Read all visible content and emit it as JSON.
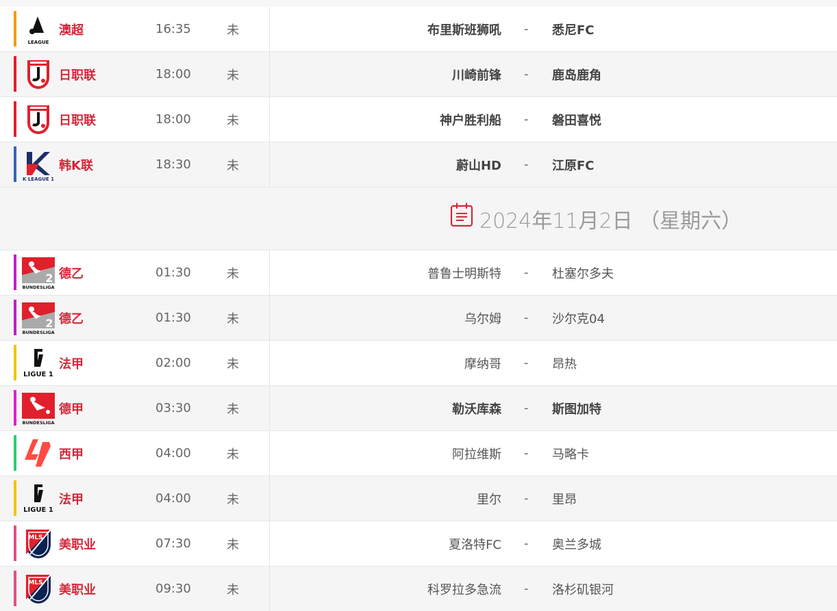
{
  "date_separator": {
    "date": "2024年11月2日",
    "weekday": "（星期六）",
    "icon": "calendar-icon"
  },
  "matches_before": [
    {
      "league": "澳超",
      "logo": "a-league-logo",
      "color": "#f39c12",
      "time": "16:35",
      "status": "未",
      "home": "布里斯班狮吼",
      "dash": "-",
      "away": "悉尼FC",
      "bold": true,
      "bg": "white"
    },
    {
      "league": "日职联",
      "logo": "j-league-logo",
      "color": "#e0202c",
      "time": "18:00",
      "status": "未",
      "home": "川崎前锋",
      "dash": "-",
      "away": "鹿岛鹿角",
      "bold": true,
      "bg": "grey"
    },
    {
      "league": "日职联",
      "logo": "j-league-logo",
      "color": "#e0202c",
      "time": "18:00",
      "status": "未",
      "home": "神户胜利船",
      "dash": "-",
      "away": "磐田喜悦",
      "bold": true,
      "bg": "white"
    },
    {
      "league": "韩K联",
      "logo": "k-league-logo",
      "color": "#3a62b8",
      "time": "18:30",
      "status": "未",
      "home": "蔚山HD",
      "dash": "-",
      "away": "江原FC",
      "bold": true,
      "bg": "grey"
    }
  ],
  "matches_after": [
    {
      "league": "德乙",
      "logo": "bundesliga-2-logo",
      "color": "#c21fc2",
      "time": "01:30",
      "status": "未",
      "home": "普鲁士明斯特",
      "dash": "-",
      "away": "杜塞尔多夫",
      "bold": false,
      "bg": "white"
    },
    {
      "league": "德乙",
      "logo": "bundesliga-2-logo",
      "color": "#c21fc2",
      "time": "01:30",
      "status": "未",
      "home": "乌尔姆",
      "dash": "-",
      "away": "沙尔克04",
      "bold": false,
      "bg": "grey"
    },
    {
      "league": "法甲",
      "logo": "ligue-1-logo",
      "color": "#f1c40f",
      "time": "02:00",
      "status": "未",
      "home": "摩纳哥",
      "dash": "-",
      "away": "昂热",
      "bold": false,
      "bg": "white"
    },
    {
      "league": "德甲",
      "logo": "bundesliga-logo",
      "color": "#e020c8",
      "time": "03:30",
      "status": "未",
      "home": "勒沃库森",
      "dash": "-",
      "away": "斯图加特",
      "bold": true,
      "bg": "grey"
    },
    {
      "league": "西甲",
      "logo": "laliga-logo",
      "color": "#2ecc71",
      "time": "04:00",
      "status": "未",
      "home": "阿拉维斯",
      "dash": "-",
      "away": "马略卡",
      "bold": false,
      "bg": "white"
    },
    {
      "league": "法甲",
      "logo": "ligue-1-logo",
      "color": "#f1c40f",
      "time": "04:00",
      "status": "未",
      "home": "里尔",
      "dash": "-",
      "away": "里昂",
      "bold": false,
      "bg": "grey"
    },
    {
      "league": "美职业",
      "logo": "mls-logo",
      "color": "#e0508a",
      "time": "07:30",
      "status": "未",
      "home": "夏洛特FC",
      "dash": "-",
      "away": "奥兰多城",
      "bold": false,
      "bg": "white"
    },
    {
      "league": "美职业",
      "logo": "mls-logo",
      "color": "#e0508a",
      "time": "09:30",
      "status": "未",
      "home": "科罗拉多急流",
      "dash": "-",
      "away": "洛杉矶银河",
      "bold": false,
      "bg": "grey"
    }
  ],
  "logo_text": {
    "a_league": "LEAGUE",
    "k_league": "K LEAGUE 1",
    "bundesliga": "BUNDESLIGA",
    "bundesliga_2_number": "2",
    "ligue_1": "LIGUE 1",
    "mls": "MLS"
  }
}
